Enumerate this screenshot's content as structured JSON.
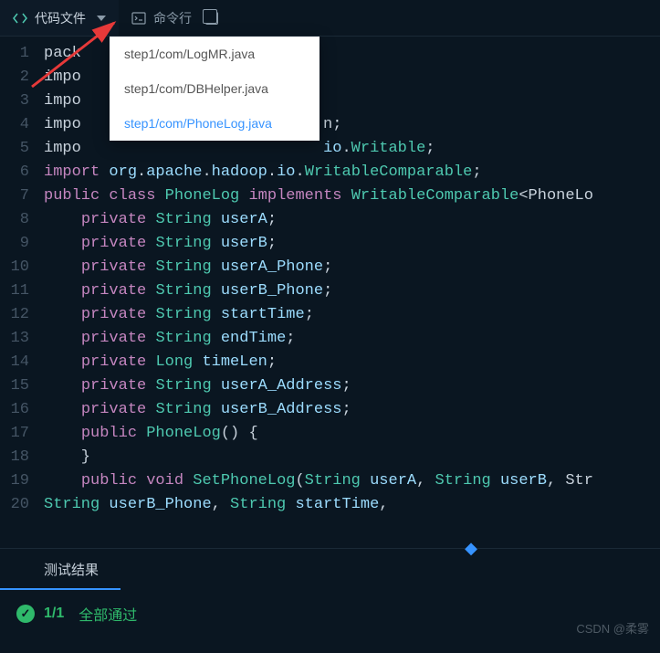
{
  "tabs": {
    "code": {
      "label": "代码文件"
    },
    "terminal": {
      "label": "命令行"
    }
  },
  "dropdown": {
    "items": [
      {
        "label": "step1/com/LogMR.java"
      },
      {
        "label": "step1/com/DBHelper.java"
      },
      {
        "label": "step1/com/PhoneLog.java"
      }
    ]
  },
  "code_lines": [
    "pack",
    "impo",
    "impo",
    "impo                          n;",
    "impo                          io.Writable;",
    "import org.apache.hadoop.io.WritableComparable;",
    "public class PhoneLog implements WritableComparable<PhoneLo",
    "    private String userA;",
    "    private String userB;",
    "    private String userA_Phone;",
    "    private String userB_Phone;",
    "    private String startTime;",
    "    private String endTime;",
    "    private Long timeLen;",
    "    private String userA_Address;",
    "    private String userB_Address;",
    "    public PhoneLog() {",
    "    }",
    "    public void SetPhoneLog(String userA, String userB, Str",
    "String userB_Phone, String startTime,"
  ],
  "results": {
    "tab_label": "测试结果",
    "score": "1/1",
    "status": "全部通过"
  },
  "watermark": "CSDN @柔雾"
}
